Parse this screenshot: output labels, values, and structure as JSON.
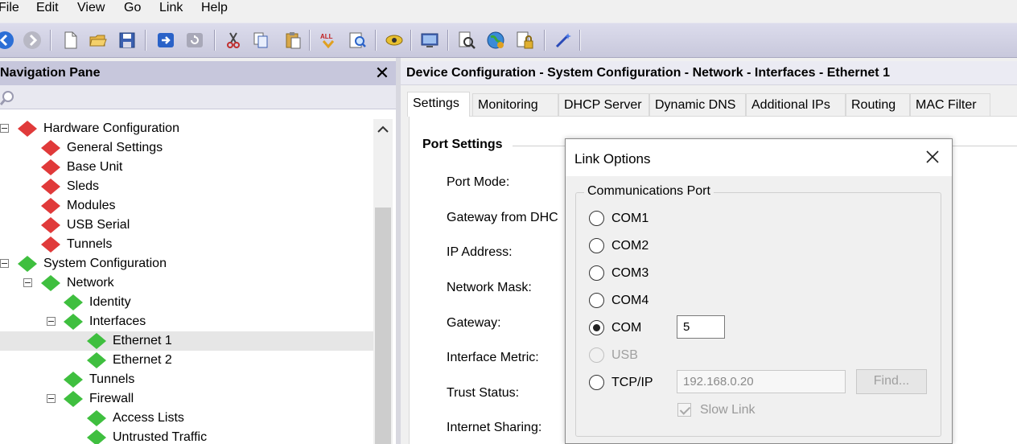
{
  "menu": [
    "File",
    "Edit",
    "View",
    "Go",
    "Link",
    "Help"
  ],
  "toolbar": {
    "icons": [
      "back-icon",
      "forward-icon",
      "new-document-icon",
      "open-folder-icon",
      "save-icon",
      "link-icon",
      "refresh-icon",
      "cut-icon",
      "copy-icon",
      "paste-icon",
      "select-all-icon",
      "find-icon",
      "connect-icon",
      "monitor-icon",
      "inspect-icon",
      "globe-icon",
      "lock-icon",
      "wand-icon"
    ]
  },
  "nav": {
    "title": "Navigation Pane",
    "close": "✕",
    "tree": [
      {
        "label": "Hardware Configuration",
        "status": "red"
      },
      {
        "label": "General Settings",
        "status": "red"
      },
      {
        "label": "Base Unit",
        "status": "red"
      },
      {
        "label": "Sleds",
        "status": "red"
      },
      {
        "label": "Modules",
        "status": "red"
      },
      {
        "label": "USB Serial",
        "status": "red"
      },
      {
        "label": "Tunnels",
        "status": "red"
      },
      {
        "label": "System Configuration",
        "status": "green"
      },
      {
        "label": "Network",
        "status": "green"
      },
      {
        "label": "Identity",
        "status": "green"
      },
      {
        "label": "Interfaces",
        "status": "green"
      },
      {
        "label": "Ethernet 1",
        "status": "green"
      },
      {
        "label": "Ethernet 2",
        "status": "green"
      },
      {
        "label": "Tunnels",
        "status": "green"
      },
      {
        "label": "Firewall",
        "status": "green"
      },
      {
        "label": "Access Lists",
        "status": "green"
      },
      {
        "label": "Untrusted Traffic",
        "status": "green"
      }
    ]
  },
  "main": {
    "title": "Device Configuration - System Configuration - Network - Interfaces - Ethernet 1",
    "tabs": [
      "Settings",
      "Monitoring",
      "DHCP Server",
      "Dynamic DNS",
      "Additional IPs",
      "Routing",
      "MAC Filter"
    ],
    "group_title": "Port Settings",
    "fields": [
      "Port Mode:",
      "Gateway from DHC",
      "IP Address:",
      "Network Mask:",
      "Gateway:",
      "Interface Metric:",
      "Trust Status:",
      "Internet Sharing:"
    ]
  },
  "dialog": {
    "title": "Link Options",
    "group": "Communications Port",
    "options": [
      "COM1",
      "COM2",
      "COM3",
      "COM4",
      "COM",
      "USB",
      "TCP/IP"
    ],
    "selected": "COM",
    "com_number": "5",
    "tcp_address": "192.168.0.20",
    "find_button": "Find...",
    "slow_link": "Slow Link"
  },
  "colors": {
    "status_red": "#e03a3a",
    "status_green": "#3fbf3f",
    "toolbar_bg": "#d0d0e2",
    "nav_header": "#c7c7dc"
  }
}
